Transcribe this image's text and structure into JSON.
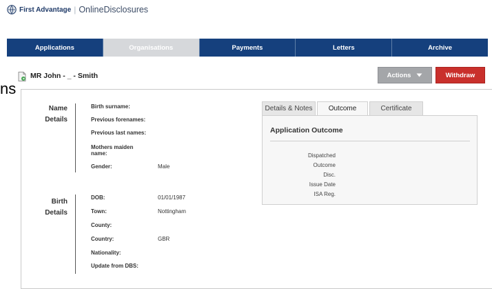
{
  "header": {
    "brand_primary": "First Advantage",
    "brand_separator": "|",
    "brand_secondary": "OnlineDisclosures"
  },
  "nav": {
    "tabs": [
      "Applications",
      "Organisations",
      "Payments",
      "Letters",
      "Archive"
    ],
    "active_index": 1
  },
  "applicant": {
    "name": "MR John - _ - Smith"
  },
  "actions": {
    "actions_label": "Actions",
    "withdraw_label": "Withdraw"
  },
  "cutoff_text": "ns",
  "name_details": {
    "title_line1": "Name",
    "title_line2": "Details",
    "fields": [
      {
        "label": "Birth surname:",
        "value": ""
      },
      {
        "label": "Previous forenames:",
        "value": ""
      },
      {
        "label": "Previous last names:",
        "value": ""
      },
      {
        "label": "Mothers maiden name:",
        "value": ""
      },
      {
        "label": "Gender:",
        "value": "Male"
      }
    ]
  },
  "birth_details": {
    "title_line1": "Birth",
    "title_line2": "Details",
    "fields": [
      {
        "label": "DOB:",
        "value": "01/01/1987"
      },
      {
        "label": "Town:",
        "value": "Nottingham"
      },
      {
        "label": "County:",
        "value": ""
      },
      {
        "label": "Country:",
        "value": "GBR"
      },
      {
        "label": "Nationality:",
        "value": ""
      },
      {
        "label": "Update from DBS:",
        "value": ""
      }
    ]
  },
  "right_panel": {
    "tabs": [
      "Details & Notes",
      "Outcome",
      "Certificate"
    ],
    "active_index": 1,
    "title": "Application Outcome",
    "rows": [
      "Dispatched",
      "Outcome",
      "Disc.",
      "Issue Date",
      "ISA Reg."
    ]
  },
  "colors": {
    "nav_bg": "#15407d",
    "nav_active_bg": "#d6d8db",
    "withdraw_bg": "#c9302c",
    "actions_bg": "#a4a6a9"
  }
}
